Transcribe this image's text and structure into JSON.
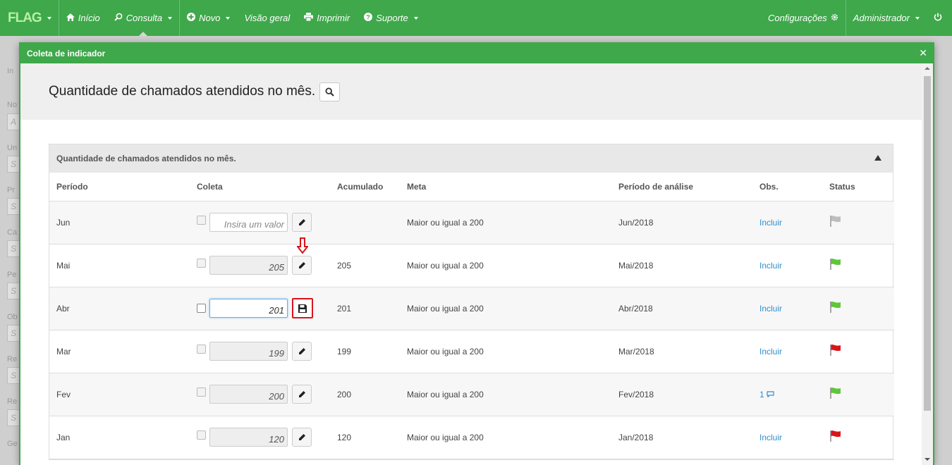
{
  "navbar": {
    "brand": "FLAG",
    "items": [
      {
        "label": "Início",
        "icon": "home-icon"
      },
      {
        "label": "Consulta",
        "icon": "search-icon"
      },
      {
        "label": "Novo",
        "icon": "plus-circle-icon"
      },
      {
        "label": "Visão geral",
        "icon": ""
      },
      {
        "label": "Imprimir",
        "icon": "print-icon"
      },
      {
        "label": "Suporte",
        "icon": "question-icon"
      }
    ],
    "settings": "Configurações",
    "user": "Administrador"
  },
  "modal": {
    "title": "Coleta de indicador",
    "heading": "Quantidade de chamados atendidos no mês.",
    "panel_title": "Quantidade de chamados atendidos no mês.",
    "columns": [
      "Período",
      "Coleta",
      "Acumulado",
      "Meta",
      "Período de análise",
      "Obs.",
      "Status"
    ],
    "placeholder": "Insira um valor",
    "rows": [
      {
        "periodo": "Jun",
        "coleta": "",
        "acumulado": "",
        "meta": "Maior ou igual a 200",
        "analise": "Jun/2018",
        "obs": "Incluir",
        "status": "gray"
      },
      {
        "periodo": "Mai",
        "coleta": "205",
        "acumulado": "205",
        "meta": "Maior ou igual a 200",
        "analise": "Mai/2018",
        "obs": "Incluir",
        "status": "green"
      },
      {
        "periodo": "Abr",
        "coleta": "201",
        "acumulado": "201",
        "meta": "Maior ou igual a 200",
        "analise": "Abr/2018",
        "obs": "Incluir",
        "status": "green"
      },
      {
        "periodo": "Mar",
        "coleta": "199",
        "acumulado": "199",
        "meta": "Maior ou igual a 200",
        "analise": "Mar/2018",
        "obs": "Incluir",
        "status": "red"
      },
      {
        "periodo": "Fev",
        "coleta": "200",
        "acumulado": "200",
        "meta": "Maior ou igual a 200",
        "analise": "Fev/2018",
        "obs": "1",
        "status": "green"
      },
      {
        "periodo": "Jan",
        "coleta": "120",
        "acumulado": "120",
        "meta": "Maior ou igual a 200",
        "analise": "Jan/2018",
        "obs": "Incluir",
        "status": "red"
      }
    ]
  },
  "colors": {
    "brand_green": "#3ea84a",
    "link": "#2f8fd0",
    "flag_green": "#5fc63a",
    "flag_red": "#d9151b",
    "flag_gray": "#bdbdbd",
    "annotation": "#d9151b"
  }
}
